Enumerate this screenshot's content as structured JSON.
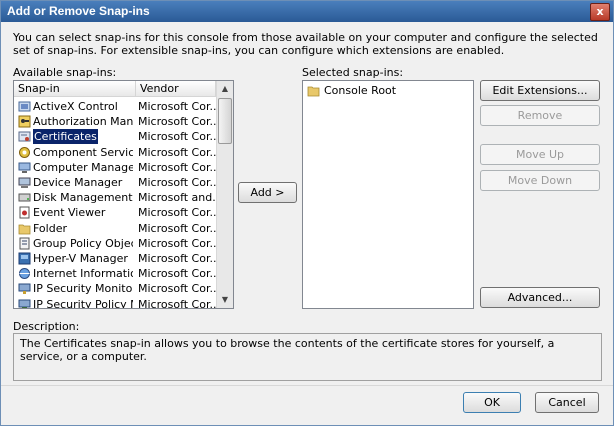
{
  "window": {
    "title": "Add or Remove Snap-ins",
    "close_glyph": "x"
  },
  "intro": "You can select snap-ins for this console from those available on your computer and configure the selected set of snap-ins. For extensible snap-ins, you can configure which extensions are enabled.",
  "available": {
    "label": "Available snap-ins:",
    "columns": [
      "Snap-in",
      "Vendor"
    ],
    "items": [
      {
        "name": "ActiveX Control",
        "vendor": "Microsoft Cor...",
        "icon": "activex-icon"
      },
      {
        "name": "Authorization Manager",
        "vendor": "Microsoft Cor...",
        "icon": "authorization-icon"
      },
      {
        "name": "Certificates",
        "vendor": "Microsoft Cor...",
        "icon": "certificate-icon",
        "selected": true
      },
      {
        "name": "Component Services",
        "vendor": "Microsoft Cor...",
        "icon": "component-services-icon"
      },
      {
        "name": "Computer Managem...",
        "vendor": "Microsoft Cor...",
        "icon": "computer-management-icon"
      },
      {
        "name": "Device Manager",
        "vendor": "Microsoft Cor...",
        "icon": "device-manager-icon"
      },
      {
        "name": "Disk Management",
        "vendor": "Microsoft and...",
        "icon": "disk-icon"
      },
      {
        "name": "Event Viewer",
        "vendor": "Microsoft Cor...",
        "icon": "event-viewer-icon"
      },
      {
        "name": "Folder",
        "vendor": "Microsoft Cor...",
        "icon": "folder-icon"
      },
      {
        "name": "Group Policy Object ...",
        "vendor": "Microsoft Cor...",
        "icon": "group-policy-icon"
      },
      {
        "name": "Hyper-V Manager",
        "vendor": "Microsoft Cor...",
        "icon": "hyperv-icon"
      },
      {
        "name": "Internet Information...",
        "vendor": "Microsoft Cor...",
        "icon": "iis-icon"
      },
      {
        "name": "IP Security Monitor",
        "vendor": "Microsoft Cor...",
        "icon": "ip-security-icon"
      },
      {
        "name": "IP Security Policy Ma...",
        "vendor": "Microsoft Cor...",
        "icon": "ip-security-policy-icon"
      }
    ]
  },
  "add_button": "Add >",
  "selected": {
    "label": "Selected snap-ins:",
    "items": [
      {
        "name": "Console Root",
        "icon": "folder-icon"
      }
    ]
  },
  "buttons": {
    "edit_extensions": "Edit Extensions...",
    "remove": "Remove",
    "move_up": "Move Up",
    "move_down": "Move Down",
    "advanced": "Advanced...",
    "ok": "OK",
    "cancel": "Cancel"
  },
  "description": {
    "label": "Description:",
    "text": "The Certificates snap-in allows you to browse the contents of the certificate stores for yourself, a service, or a computer."
  }
}
